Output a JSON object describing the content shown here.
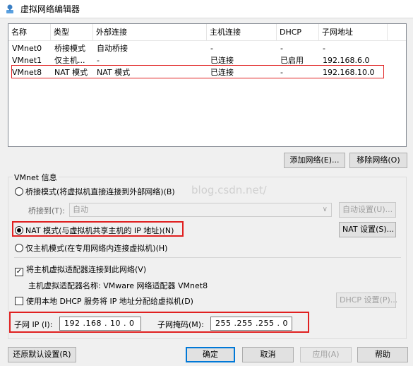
{
  "window": {
    "title": "虚拟网络编辑器"
  },
  "table": {
    "columns": [
      "名称",
      "类型",
      "外部连接",
      "主机连接",
      "DHCP",
      "子网地址"
    ],
    "rows": [
      [
        "VMnet0",
        "桥接模式",
        "自动桥接",
        "-",
        "-",
        "-"
      ],
      [
        "VMnet1",
        "仅主机...",
        "-",
        "已连接",
        "已启用",
        "192.168.6.0"
      ],
      [
        "VMnet8",
        "NAT 模式",
        "NAT 模式",
        "已连接",
        "-",
        "192.168.10.0"
      ]
    ]
  },
  "buttons": {
    "add_network": "添加网络(E)...",
    "remove_network": "移除网络(O)",
    "auto_settings": "自动设置(U)...",
    "nat_settings": "NAT 设置(S)...",
    "dhcp_settings": "DHCP 设置(P)...",
    "restore_defaults": "还原默认设置(R)",
    "ok": "确定",
    "cancel": "取消",
    "apply": "应用(A)",
    "help": "帮助"
  },
  "vmnet_info": {
    "title": "VMnet 信息",
    "bridge_radio": "桥接模式(将虚拟机直接连接到外部网络)(B)",
    "bridged_to_label": "桥接到(T):",
    "bridged_to_value": "自动",
    "nat_radio": "NAT 模式(与虚拟机共享主机的 IP 地址)(N)",
    "hostonly_radio": "仅主机模式(在专用网络内连接虚拟机)(H)",
    "connect_adapter_check": "将主机虚拟适配器连接到此网络(V)",
    "adapter_name_label": "主机虚拟适配器名称: VMware 网络适配器 VMnet8",
    "dhcp_check": "使用本地 DHCP 服务将 IP 地址分配给虚拟机(D)",
    "subnet_ip_label": "子网 IP (I):",
    "subnet_ip_value": "192 .168 . 10  .  0",
    "subnet_mask_label": "子网掩码(M):",
    "subnet_mask_value": "255 .255 .255 .  0"
  },
  "watermark": "blog.csdn.net/"
}
